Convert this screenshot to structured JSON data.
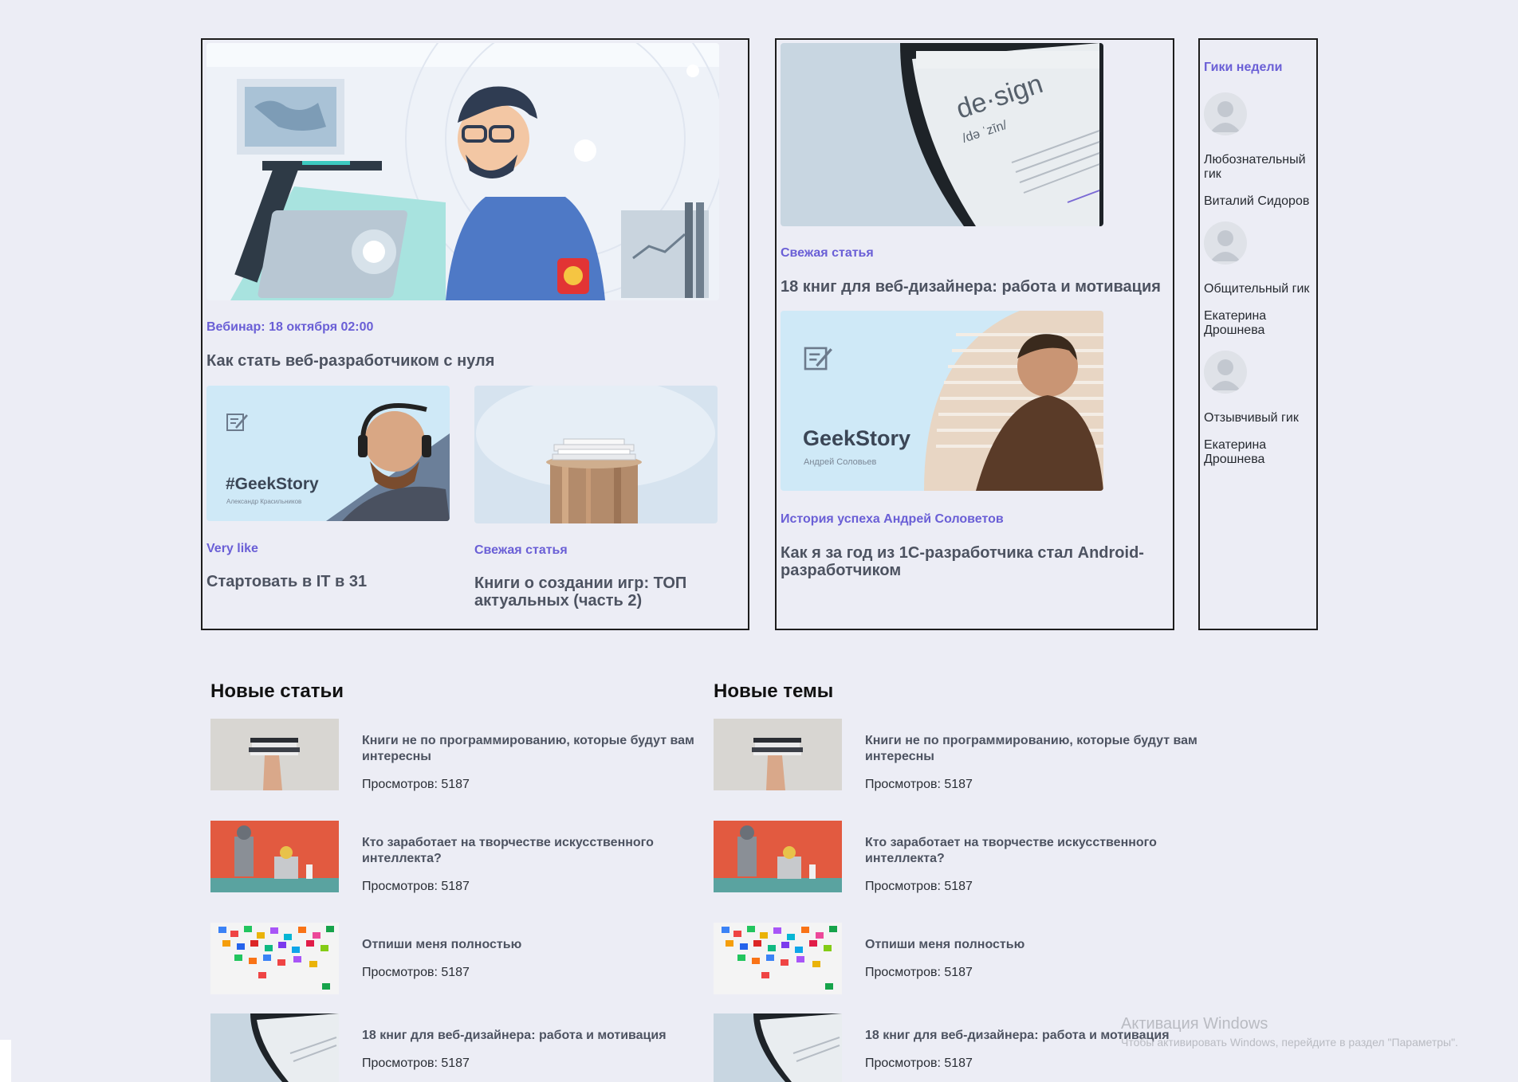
{
  "featured": {
    "main": {
      "meta": "Вебинар: 18 октября 02:00",
      "title": "Как стать веб-разработчиком с нуля"
    },
    "small1": {
      "badge": "#GeekStory",
      "author_caption": "Александр Красильников",
      "meta": "Very like",
      "title": "Стартовать в IT в 31"
    },
    "small2": {
      "meta": "Свежая статья",
      "title": "Книги о создании игр: ТОП актуальных (часть 2)"
    }
  },
  "middle": {
    "card1": {
      "image_word": "de·sign",
      "image_phon": "/də ˈzīn/",
      "meta": "Свежая статья",
      "title": "18 книг для веб-дизайнера: работа и мотивация"
    },
    "card2": {
      "badge": "GeekStory",
      "author_caption": "Андрей Соловьев",
      "meta": "История успеха Андрей Соловетов",
      "title": "Как я за год из 1С-разработчика стал Android-разработчиком"
    }
  },
  "geeks": {
    "heading": "Гики недели",
    "items": [
      {
        "title": "Любознательный гик",
        "name": "Виталий Сидоров"
      },
      {
        "title": "Общительный гик",
        "name": "Екатерина Дрошнева"
      },
      {
        "title": "Отзывчивый гик",
        "name": "Екатерина Дрошнева"
      }
    ]
  },
  "articles": {
    "new_articles_title": "Новые статьи",
    "new_topics_title": "Новые темы",
    "items": [
      {
        "title": "Книги не по программированию, которые будут вам интересны",
        "views": "Просмотров: 5187"
      },
      {
        "title": "Кто заработает на творчестве искусственного интеллекта?",
        "views": "Просмотров: 5187"
      },
      {
        "title": "Отпиши меня полностью",
        "views": "Просмотров: 5187"
      },
      {
        "title": "18 книг для веб-дизайнера: работа и мотивация",
        "views": "Просмотров: 5187"
      }
    ]
  },
  "watermark": {
    "line1": "Активация Windows",
    "line2": "Чтобы активировать Windows, перейдите в раздел \"Параметры\"."
  },
  "colors": {
    "accent": "#6a5fd6",
    "background": "#ecedf5",
    "border": "#1d1d1d"
  },
  "icons": [
    "note-pen-icon",
    "user-avatar-icon"
  ]
}
